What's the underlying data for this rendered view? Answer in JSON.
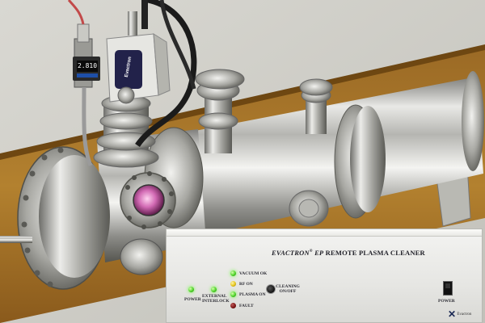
{
  "controller": {
    "brand": "EVACTRON",
    "model": "EP",
    "product": "REMOTE PLASMA CLEANER",
    "indicators": {
      "power": "POWER",
      "external_interlock": "EXTERNAL INTERLOCK",
      "vacuum_ok": "VACUUM OK",
      "rf_on": "RF ON",
      "plasma_on": "PLASMA ON",
      "fault": "FAULT"
    },
    "cleaning_button": "CLEANING ON/OFF",
    "power_switch": "POWER",
    "logo": "Evactron"
  },
  "gauge": {
    "reading": "2.810",
    "label": "Evactron"
  },
  "colors": {
    "led_green": "#4fd42a",
    "led_yellow": "#e6c51c",
    "led_red": "#7a1414",
    "viewport_glow": "#d26ab4"
  }
}
